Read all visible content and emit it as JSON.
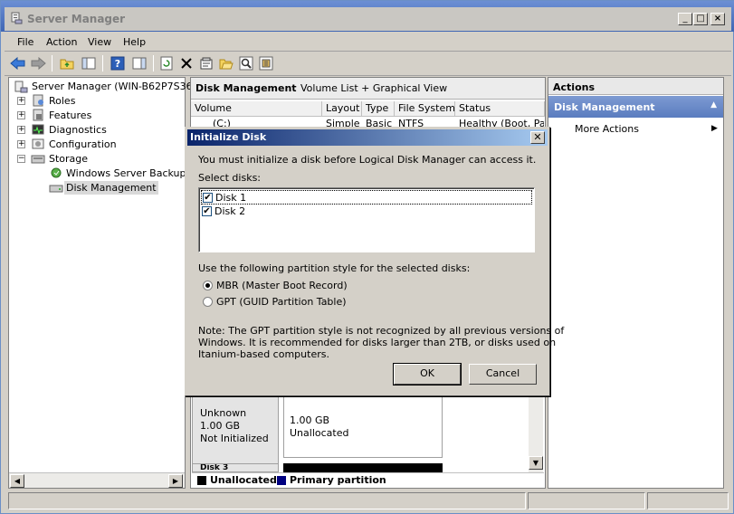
{
  "window": {
    "title": "Server Manager"
  },
  "menu": [
    "File",
    "Action",
    "View",
    "Help"
  ],
  "tree": {
    "root": "Server Manager (WIN-B62P7S3667",
    "items": [
      "Roles",
      "Features",
      "Diagnostics",
      "Configuration",
      "Storage"
    ],
    "storage_children": [
      "Windows Server Backup",
      "Disk Management"
    ]
  },
  "center": {
    "title": "Disk Management",
    "view": "Volume List + Graphical View",
    "columns": [
      "Volume",
      "Layout",
      "Type",
      "File System",
      "Status"
    ],
    "row": [
      "(C:)",
      "Simple",
      "Basic",
      "NTFS",
      "Healthy (Boot, Pag"
    ],
    "disk_info": {
      "line1": "Unknown",
      "line2": "1.00 GB",
      "line3": "Not Initialized"
    },
    "partition": {
      "size": "1.00 GB",
      "state": "Unallocated"
    },
    "next_disk": "Disk 3",
    "legend": {
      "unallocated": "Unallocated",
      "primary": "Primary partition"
    }
  },
  "actions": {
    "header": "Actions",
    "section": "Disk Management",
    "items": [
      "More Actions"
    ]
  },
  "dialog": {
    "title": "Initialize Disk",
    "intro": "You must initialize a disk before Logical Disk Manager can access it.",
    "select_label": "Select disks:",
    "disks": [
      "Disk 1",
      "Disk 2"
    ],
    "style_label": "Use the following partition style for the selected disks:",
    "options": [
      "MBR (Master Boot Record)",
      "GPT (GUID Partition Table)"
    ],
    "note_l1": "Note: The GPT partition style is not recognized by all previous versions of",
    "note_l2": "Windows. It is recommended for disks larger than 2TB, or disks used on",
    "note_l3": "Itanium-based computers.",
    "ok": "OK",
    "cancel": "Cancel"
  },
  "colors": {
    "accent": "#0a246a",
    "actions_header": "#6f8fcb",
    "primary_partition": "#000080"
  }
}
